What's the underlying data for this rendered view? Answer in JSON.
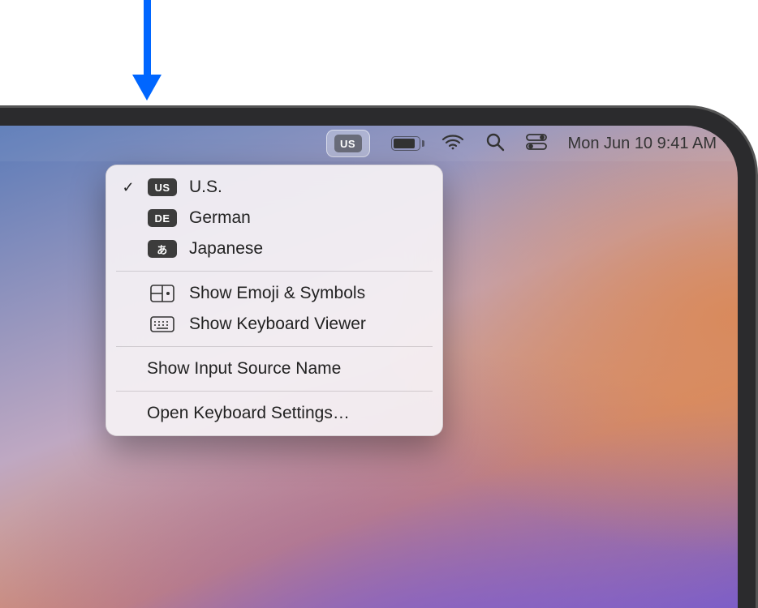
{
  "menubar": {
    "input_badge": "US",
    "datetime": "Mon Jun 10  9:41 AM"
  },
  "dropdown": {
    "sources": [
      {
        "code": "US",
        "label": "U.S.",
        "selected": true
      },
      {
        "code": "DE",
        "label": "German",
        "selected": false
      },
      {
        "code": "あ",
        "label": "Japanese",
        "selected": false
      }
    ],
    "show_emoji": "Show Emoji & Symbols",
    "show_viewer": "Show Keyboard Viewer",
    "show_name": "Show Input Source Name",
    "open_settings": "Open Keyboard Settings…"
  }
}
